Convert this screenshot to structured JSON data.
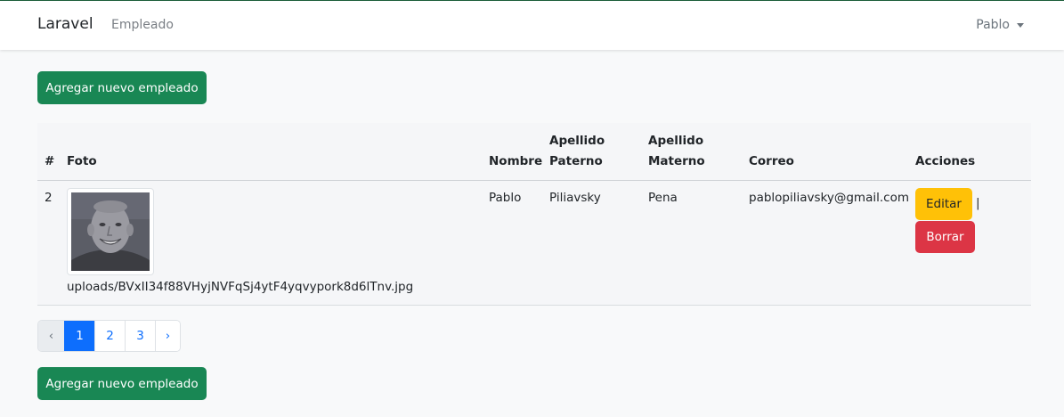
{
  "navbar": {
    "brand": "Laravel",
    "link": "Empleado",
    "user": "Pablo"
  },
  "actions": {
    "add_label": "Agregar nuevo empleado"
  },
  "table": {
    "headers": {
      "num": "#",
      "foto": "Foto",
      "nombre": "Nombre",
      "apellido_paterno_1": "Apellido",
      "apellido_paterno_2": "Paterno",
      "apellido_materno_1": "Apellido",
      "apellido_materno_2": "Materno",
      "correo": "Correo",
      "acciones": "Acciones"
    },
    "rows": [
      {
        "id": "2",
        "photo_path": "uploads/BVxII34f88VHyjNVFqSj4ytF4yqvypork8d6lTnv.jpg",
        "nombre": "Pablo",
        "apellido_paterno": "Piliavsky",
        "apellido_materno": "Pena",
        "correo": "pablopiliavsky@gmail.com",
        "edit_label": "Editar",
        "separator": "|",
        "delete_label": "Borrar"
      }
    ]
  },
  "pagination": {
    "prev": "‹",
    "pages": [
      "1",
      "2",
      "3"
    ],
    "next": "›",
    "current": "1"
  },
  "colors": {
    "primary": "#0d6efd",
    "success": "#198754",
    "warning": "#ffc107",
    "danger": "#dc3545"
  }
}
